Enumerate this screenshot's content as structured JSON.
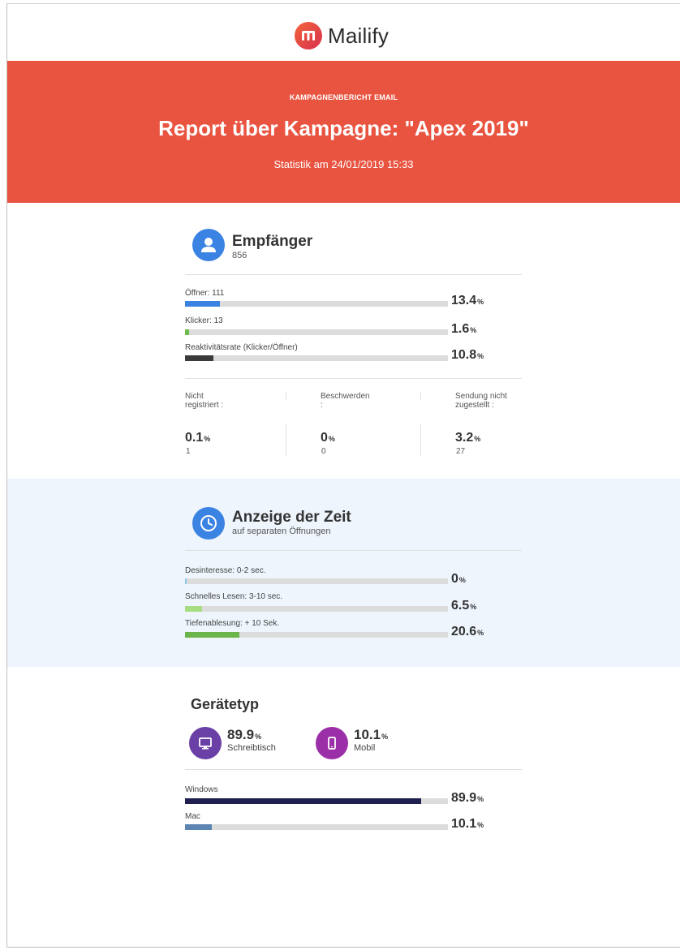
{
  "brand": {
    "name": "Mailify"
  },
  "header": {
    "eyebrow": "KAMPAGNENBERICHT EMAIL",
    "title": "Report über Kampagne: \"Apex 2019\"",
    "date": "Statistik am 24/01/2019 15:33"
  },
  "recipients": {
    "title": "Empfänger",
    "count": "856",
    "metrics": [
      {
        "label": "Öffner: 111",
        "value": "13.4",
        "percent": 13.4,
        "color": "#3a83e3"
      },
      {
        "label": "Klicker: 13",
        "value": "1.6",
        "percent": 1.6,
        "color": "#6cbe4a"
      },
      {
        "label": "Reaktivitätsrate (Klicker/Öffner)",
        "value": "10.8",
        "percent": 10.8,
        "color": "#3a3a3a"
      }
    ],
    "stats": [
      {
        "label_line1": "Nicht",
        "label_line2": "registriert :",
        "value": "0.1",
        "count": "1"
      },
      {
        "label_line1": "Beschwerden",
        "label_line2": ":",
        "value": "0",
        "count": "0"
      },
      {
        "label_line1": "Sendung nicht",
        "label_line2": "zugestellt :",
        "value": "3.2",
        "count": "27"
      }
    ]
  },
  "time": {
    "title": "Anzeige der Zeit",
    "subtitle": "auf separaten Öffnungen",
    "metrics": [
      {
        "label": "Desinteresse: 0-2 sec.",
        "value": "0",
        "percent": 0,
        "color": "#8cc7e8"
      },
      {
        "label": "Schnelles Lesen: 3-10 sec.",
        "value": "6.5",
        "percent": 6.5,
        "color": "#a6dd80"
      },
      {
        "label": "Tiefenablesung: + 10 Sek.",
        "value": "20.6",
        "percent": 20.6,
        "color": "#6bb54a"
      }
    ]
  },
  "devices": {
    "title": "Gerätetyp",
    "types": [
      {
        "value": "89.9",
        "label": "Schreibtisch",
        "color": "#6a3fa6",
        "icon": "monitor-icon"
      },
      {
        "value": "10.1",
        "label": "Mobil",
        "color": "#9b2fa8",
        "icon": "mobile-icon"
      }
    ],
    "os": [
      {
        "label": "Windows",
        "value": "89.9",
        "percent": 89.9,
        "color": "#1f1f4f"
      },
      {
        "label": "Mac",
        "value": "10.1",
        "percent": 10.1,
        "color": "#5c85b2"
      }
    ],
    "pct_sign": "%"
  }
}
